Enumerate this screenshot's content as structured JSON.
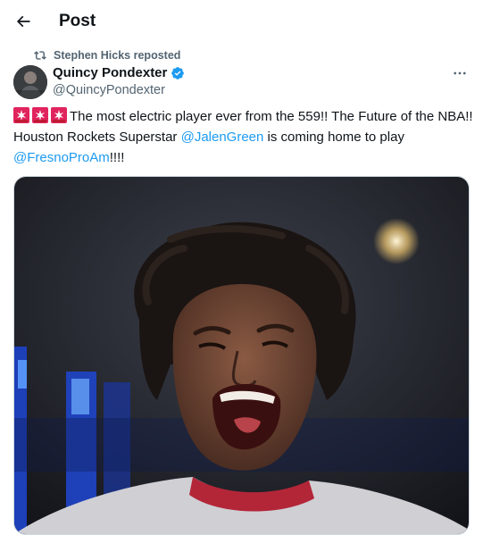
{
  "header": {
    "title": "Post",
    "back_icon": "arrow-left-icon"
  },
  "repost": {
    "icon": "repost-icon",
    "text": "Stephen Hicks reposted"
  },
  "author": {
    "name": "Quincy Pondexter",
    "handle": "@QuincyPondexter",
    "verified_icon": "verified-badge-icon",
    "verified_color": "#1d9bf0"
  },
  "more_icon": "more-horizontal-icon",
  "tweet": {
    "emoji": [
      "rotating-light-emoji",
      "rotating-light-emoji",
      "rotating-light-emoji"
    ],
    "text_part1": "The most electric player ever from the 559!! The Future of the NBA!! Houston Rockets Superstar ",
    "mention1": "@JalenGreen",
    "text_part2": " is coming home to play ",
    "mention2": "@FresnoProAm",
    "text_part3": "!!!!"
  },
  "colors": {
    "link": "#1d9bf0",
    "text": "#0f1419",
    "secondary": "#536471"
  }
}
